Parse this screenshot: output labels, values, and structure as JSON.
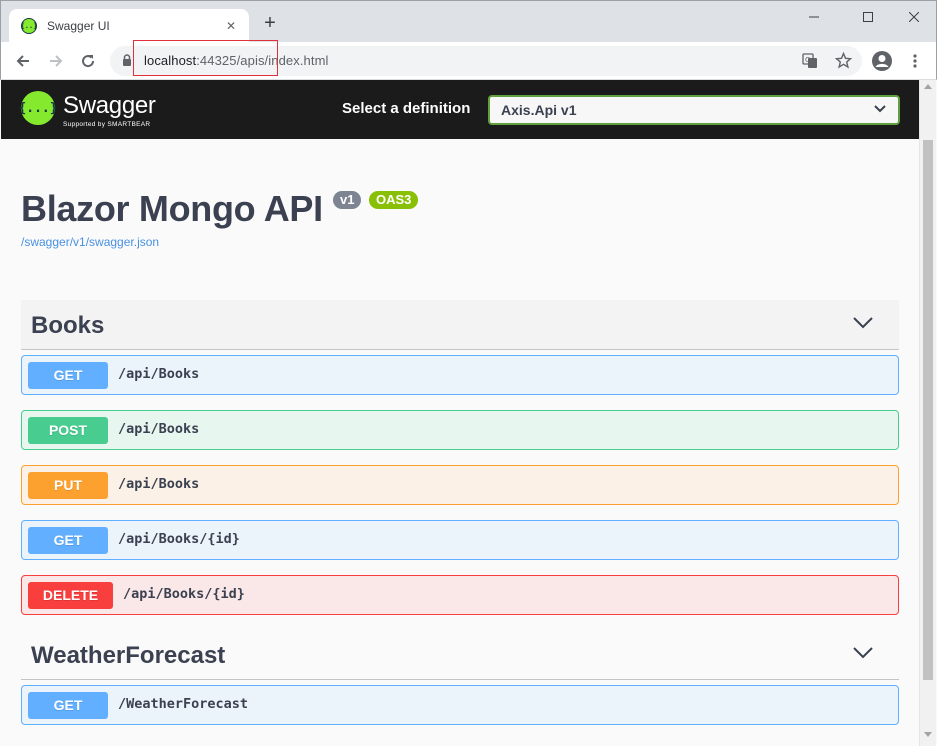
{
  "browser": {
    "tab_title": "Swagger UI",
    "tab_close": "✕",
    "new_tab": "+",
    "url_host": "localhost",
    "url_rest": ":44325/apis/index.html",
    "favicon_text": "{..}"
  },
  "topbar": {
    "logo_mark": "{...}",
    "logo_text": "Swagger",
    "logo_sub": "Supported by SMARTBEAR",
    "definition_label": "Select a definition",
    "definition_value": "Axis.Api v1"
  },
  "info": {
    "title": "Blazor Mongo API",
    "version_badge": "v1",
    "oas_badge": "OAS3",
    "spec_link": "/swagger/v1/swagger.json"
  },
  "tags": [
    {
      "name": "Books",
      "operations": [
        {
          "method": "GET",
          "path": "/api/Books"
        },
        {
          "method": "POST",
          "path": "/api/Books"
        },
        {
          "method": "PUT",
          "path": "/api/Books"
        },
        {
          "method": "GET",
          "path": "/api/Books/{id}"
        },
        {
          "method": "DELETE",
          "path": "/api/Books/{id}"
        }
      ]
    },
    {
      "name": "WeatherForecast",
      "operations": [
        {
          "method": "GET",
          "path": "/WeatherForecast"
        }
      ]
    }
  ],
  "colors": {
    "get": "#61affe",
    "post": "#49cc90",
    "put": "#fca130",
    "delete": "#f93e3e",
    "swagger_green": "#85ea2d",
    "topbar_bg": "#1b1b1b"
  }
}
